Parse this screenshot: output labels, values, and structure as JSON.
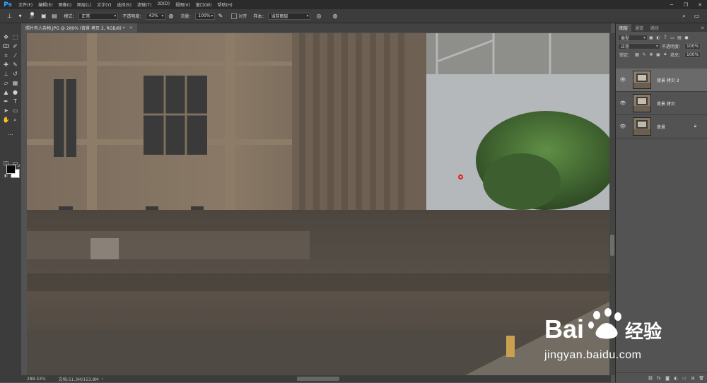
{
  "app": {
    "logo": "Ps"
  },
  "menu": [
    "文件(F)",
    "编辑(E)",
    "图像(I)",
    "图层(L)",
    "文字(Y)",
    "选择(S)",
    "滤镜(T)",
    "3D(D)",
    "视图(V)",
    "窗口(W)",
    "帮助(H)"
  ],
  "window_controls": {
    "minimize": "─",
    "restore": "❐",
    "close": "✕"
  },
  "options": {
    "brush_size": "27",
    "mode_label": "模式：",
    "mode_value": "正常",
    "opacity_label": "不透明度：",
    "opacity_value": "43%",
    "flow_label": "流量：",
    "flow_value": "100%",
    "align_label": "对齐",
    "sample_label": "样本：",
    "sample_value": "当前图层"
  },
  "document_tab": {
    "title": "照片有人杂物.JPG @ 289% (背景 拷贝 2, RGB/8) *",
    "close": "×"
  },
  "status": {
    "zoom": "288.53%",
    "doc": "文档:51.3M/153.8M"
  },
  "panel": {
    "tabs": [
      "图层",
      "通道",
      "路径"
    ],
    "filter_kind": "类型",
    "blend_mode": "正常",
    "opacity_label": "不透明度：",
    "opacity_value": "100%",
    "lock_label": "锁定：",
    "fill_label": "填充：",
    "fill_value": "100%",
    "layers": [
      {
        "name": "背景 拷贝 2",
        "selected": true,
        "locked": false
      },
      {
        "name": "背景 拷贝",
        "selected": false,
        "locked": false
      },
      {
        "name": "背景",
        "selected": false,
        "locked": true
      }
    ]
  },
  "watermark": {
    "brand": "Baidu 经验",
    "url": "jingyan.baidu.com"
  }
}
